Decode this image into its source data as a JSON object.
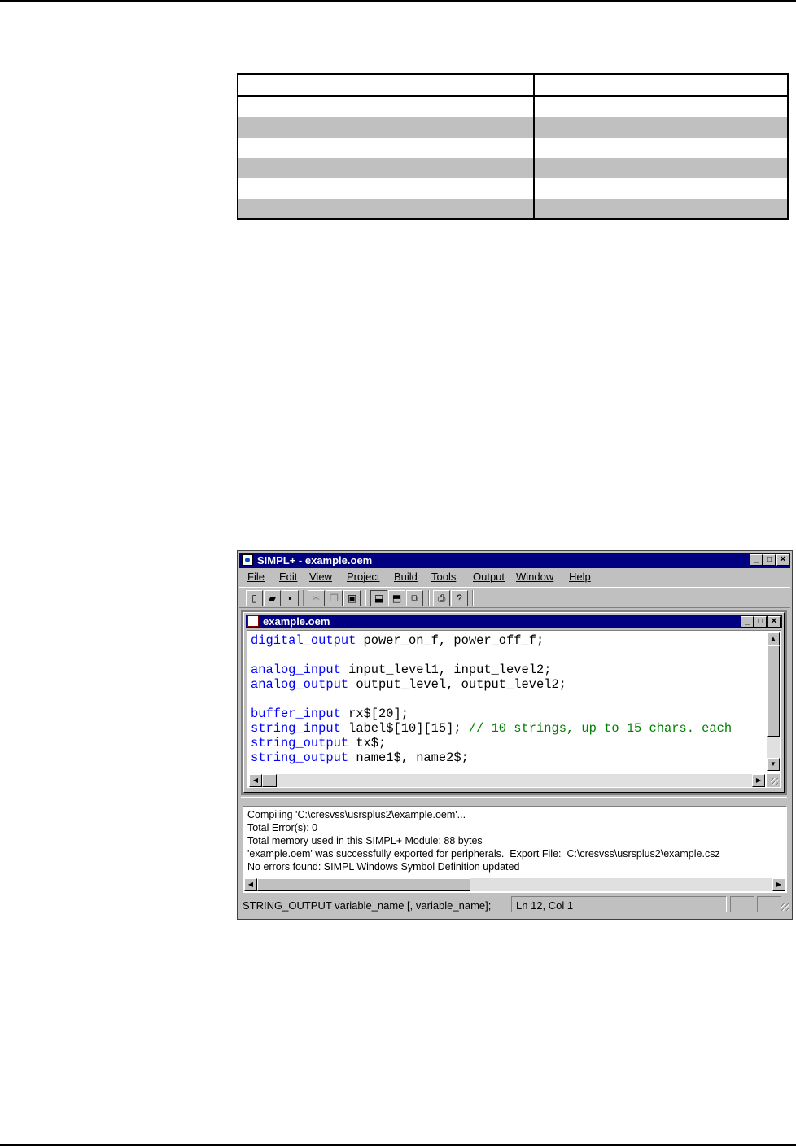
{
  "window": {
    "title": "SIMPL+ - example.oem",
    "menu": [
      "File",
      "Edit",
      "View",
      "Project",
      "Build",
      "Tools",
      "Output",
      "Window",
      "Help"
    ]
  },
  "child_window": {
    "title": "example.oem"
  },
  "editor": {
    "lines": [
      [
        {
          "t": "digital_output",
          "c": "kw"
        },
        {
          "t": " power_on_f, power_off_f;",
          "c": ""
        }
      ],
      [],
      [
        {
          "t": "analog_input",
          "c": "kw"
        },
        {
          "t": " input_level1, input_level2;",
          "c": ""
        }
      ],
      [
        {
          "t": "analog_output",
          "c": "kw"
        },
        {
          "t": " output_level, output_level2;",
          "c": ""
        }
      ],
      [],
      [
        {
          "t": "buffer_input",
          "c": "kw"
        },
        {
          "t": " rx$[20];",
          "c": ""
        }
      ],
      [
        {
          "t": "string_input",
          "c": "kw"
        },
        {
          "t": " label$[10][15]; ",
          "c": ""
        },
        {
          "t": "// 10 strings, up to 15 chars. each",
          "c": "cm"
        }
      ],
      [
        {
          "t": "string_output",
          "c": "kw"
        },
        {
          "t": " tx$;",
          "c": ""
        }
      ],
      [
        {
          "t": "string_output",
          "c": "kw"
        },
        {
          "t": " name1$, name2$;",
          "c": ""
        }
      ]
    ]
  },
  "output": {
    "lines": [
      "Compiling 'C:\\cresvss\\usrsplus2\\example.oem'...",
      "Total Error(s): 0",
      "Total memory used in this SIMPL+ Module: 88 bytes",
      "'example.oem' was successfully exported for peripherals.  Export File:  C:\\cresvss\\usrsplus2\\example.csz",
      "No errors found: SIMPL Windows Symbol Definition updated"
    ]
  },
  "statusbar": {
    "hint": "STRING_OUTPUT variable_name [, variable_name];",
    "position": "Ln 12, Col 1"
  }
}
